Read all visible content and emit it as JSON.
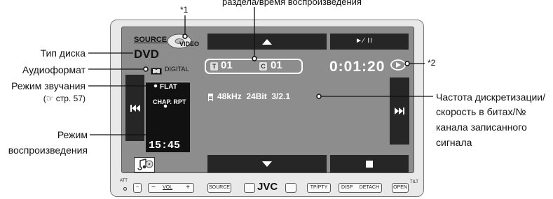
{
  "callouts": {
    "disc_type": "Тип диска",
    "audio_format": "Аудиоформат",
    "sound_mode": "Режим звучания",
    "sound_mode_ref": "(☞ стр. 57)",
    "play_mode_line1": "Режим",
    "play_mode_line2": "воспроизведения",
    "top_caption": "раздела/время воспроизведения",
    "sampling_line1": "Частота дискретизации/",
    "sampling_line2": "скорость в битах/№",
    "sampling_line3": "канала записанного",
    "sampling_line4": "сигнала",
    "note1": "*1",
    "note2": "*2"
  },
  "screen": {
    "source_label": "SOURCE",
    "disc_label": "DVD",
    "video_label": "VIDEO",
    "digital_label": "DIGITAL",
    "sound_mode_value": "FLAT",
    "play_mode_value": "CHAP. RPT",
    "clock": "15:45",
    "title_letter": "T",
    "title_number": "01",
    "chapter_letter": "C",
    "chapter_number": "01",
    "play_time": "0:01:20",
    "play_pause_label": "►⁄ II",
    "audio_info": "48kHz  24Bit  3/2.1"
  },
  "controls": {
    "att": "ATT",
    "minus": "−",
    "vol": "VOL",
    "plus": "+",
    "source": "SOURCE",
    "brand": "JVC",
    "tp_pty": "TP/PTY",
    "disp": "DISP",
    "detach": "DETACH",
    "open": "OPEN",
    "tilt": "TILT"
  }
}
